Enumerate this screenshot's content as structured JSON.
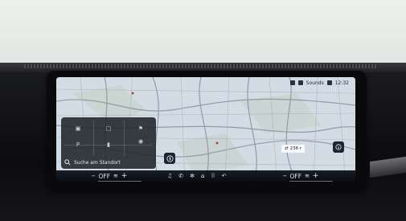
{
  "status_bar": {
    "location": "Sounds",
    "time": "12:32"
  },
  "map_widget": {
    "search_label": "Suche am Standort"
  },
  "map_overlay": {
    "distance_label": "236 r"
  },
  "climate_left": {
    "minus": "–",
    "state": "OFF",
    "plus": "+"
  },
  "climate_right": {
    "minus": "–",
    "state": "OFF",
    "plus": "+"
  },
  "nav_bar": {
    "home": "⌂",
    "music": "♫",
    "apps": "⠿"
  },
  "colors": {
    "bezel": "#0a0a0c",
    "map_bg": "#cfd8e1",
    "road": "#7e8794",
    "widget_bg": "#20242a",
    "temp_cold": "#2c6fe0",
    "temp_hot": "#e0403a"
  }
}
